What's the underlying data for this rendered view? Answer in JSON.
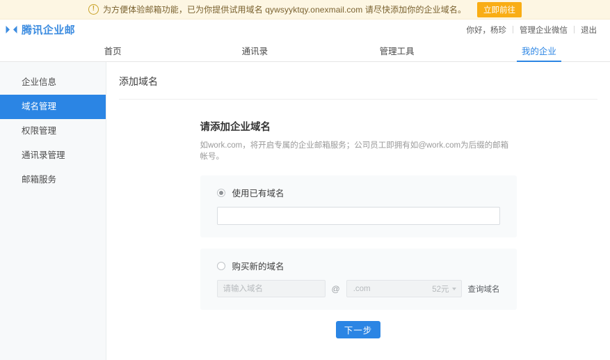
{
  "notice": {
    "icon": "info-circle-icon",
    "text": "为方便体验邮箱功能，已为你提供试用域名 qywsyyktqy.onexmail.com 请尽快添加你的企业域名。",
    "button_label": "立即前往",
    "background": "#fdf6e3",
    "button_color": "#f9ad14"
  },
  "header": {
    "logo_icon": "tencent-exmail-logo-icon",
    "brand": "腾讯企业邮",
    "greeting": "你好，杨珍",
    "manage_wecom": "管理企业微信",
    "logout": "退出"
  },
  "nav": {
    "items": [
      {
        "label": "首页",
        "active": false
      },
      {
        "label": "通讯录",
        "active": false
      },
      {
        "label": "管理工具",
        "active": false
      },
      {
        "label": "我的企业",
        "active": true
      }
    ],
    "accent": "#2b85e4"
  },
  "sidebar": {
    "items": [
      {
        "label": "企业信息",
        "active": false
      },
      {
        "label": "域名管理",
        "active": true
      },
      {
        "label": "权限管理",
        "active": false
      },
      {
        "label": "通讯录管理",
        "active": false
      },
      {
        "label": "邮箱服务",
        "active": false
      }
    ],
    "active_background": "#2b85e4"
  },
  "content": {
    "title": "添加域名",
    "form": {
      "heading": "请添加企业域名",
      "subtext": "如work.com，将开启专属的企业邮箱服务；公司员工即拥有如@work.com为后缀的邮箱帐号。",
      "option_existing": {
        "radio_label": "使用已有域名",
        "selected": true,
        "input_value": "",
        "input_placeholder": ""
      },
      "option_buy": {
        "radio_label": "购买新的域名",
        "selected": false,
        "name_placeholder": "请输入域名",
        "at_symbol": "@",
        "tld_value": ".com",
        "tld_price": "52元",
        "query_link": "查询域名"
      },
      "submit_label": "下一步",
      "submit_color": "#2b85e4"
    }
  }
}
